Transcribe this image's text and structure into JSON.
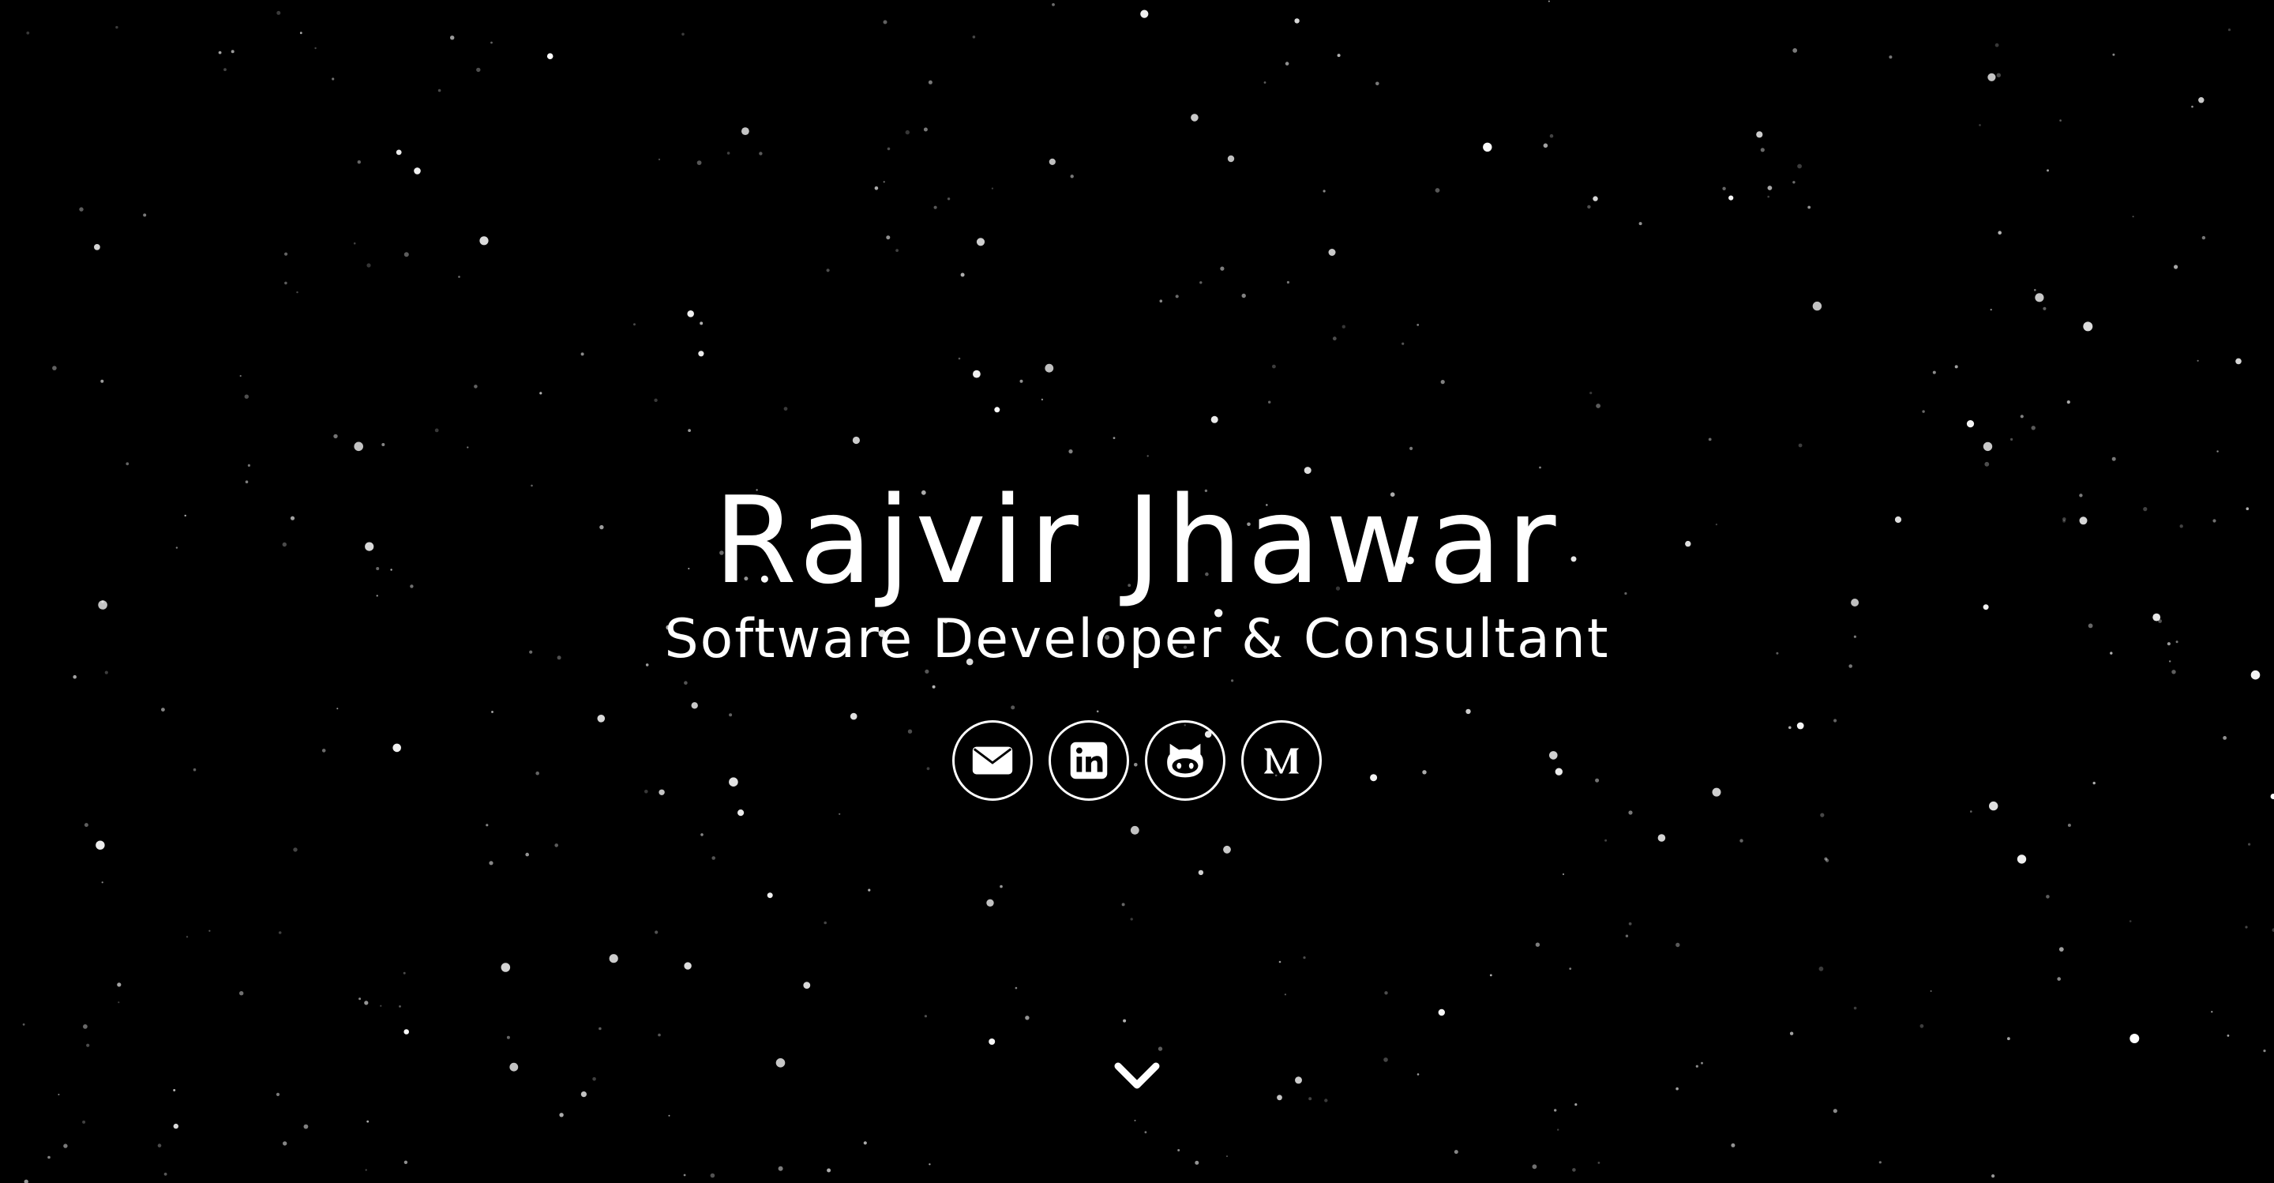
{
  "hero": {
    "name": "Rajvir Jhawar",
    "title": "Software Developer & Consultant"
  },
  "socials": [
    {
      "icon": "email-icon",
      "label": "Email"
    },
    {
      "icon": "linkedin-icon",
      "label": "LinkedIn"
    },
    {
      "icon": "github-icon",
      "label": "GitHub"
    },
    {
      "icon": "medium-icon",
      "label": "Medium"
    }
  ],
  "scroll": {
    "icon": "chevron-down-icon"
  },
  "colors": {
    "background": "#000000",
    "foreground": "#ffffff"
  }
}
